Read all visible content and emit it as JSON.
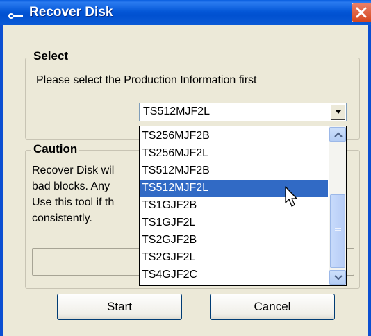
{
  "window": {
    "title": "Recover Disk"
  },
  "icons": {
    "app": "key-icon",
    "close": "close-icon",
    "dropdown": "chevron-down-icon",
    "scroll_up": "chevron-up-icon",
    "scroll_down": "chevron-down-icon",
    "cursor": "mouse-pointer-icon"
  },
  "select_group": {
    "legend": "Select",
    "instruction": "Please select the Production Information first",
    "combo_value": "TS512MJF2L"
  },
  "dropdown": {
    "options": [
      "TS256MJF2B",
      "TS256MJF2L",
      "TS512MJF2B",
      "TS512MJF2L",
      "TS1GJF2B",
      "TS1GJF2L",
      "TS2GJF2B",
      "TS2GJF2L",
      "TS4GJF2C"
    ],
    "selected_index": 3
  },
  "caution_group": {
    "legend": "Caution",
    "lines": [
      "Recover Disk wil",
      "bad blocks. Any",
      "Use this tool if th",
      "consistently."
    ]
  },
  "buttons": {
    "start": "Start",
    "cancel": "Cancel"
  },
  "colors": {
    "titlebar": "#0558d8",
    "selection": "#316ac5",
    "close": "#d6471f",
    "background": "#ece9d8"
  }
}
